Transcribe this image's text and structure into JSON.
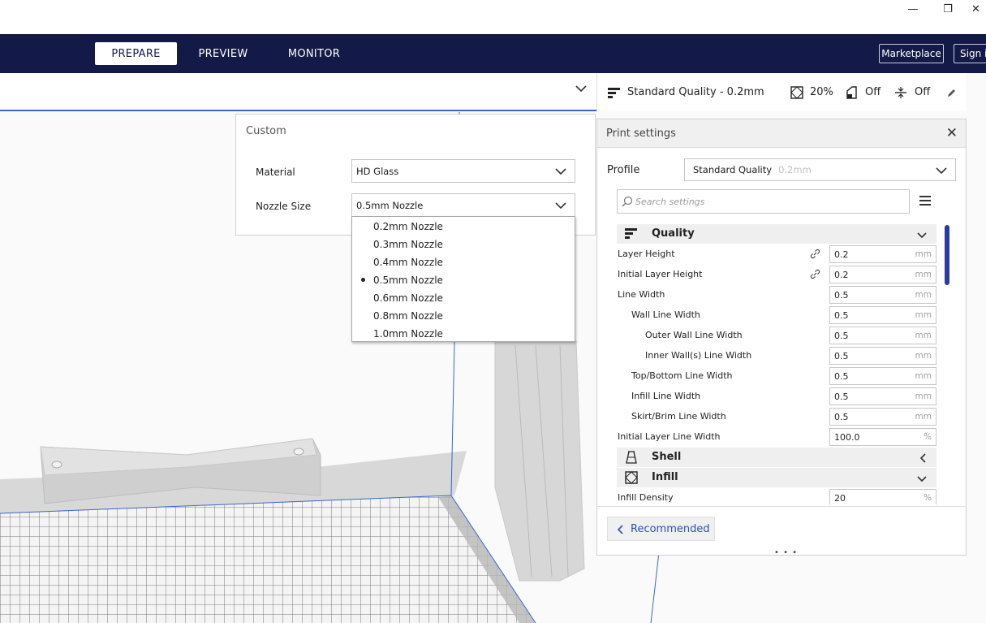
{
  "window": {
    "minimize_glyph": "—",
    "restore_glyph": "❐",
    "close_glyph": "✕"
  },
  "header": {
    "tabs": [
      {
        "label": "PREPARE",
        "active": true
      },
      {
        "label": "PREVIEW",
        "active": false
      },
      {
        "label": "MONITOR",
        "active": false
      }
    ],
    "marketplace_label": "Marketplace",
    "signin_label": "Sign in"
  },
  "material_panel": {
    "title": "Custom",
    "material_label": "Material",
    "material_value": "HD Glass",
    "nozzle_label": "Nozzle Size",
    "nozzle_value": "0.5mm Nozzle",
    "nozzle_options": [
      {
        "label": "0.2mm Nozzle",
        "selected": false
      },
      {
        "label": "0.3mm Nozzle",
        "selected": false
      },
      {
        "label": "0.4mm Nozzle",
        "selected": false
      },
      {
        "label": "0.5mm Nozzle",
        "selected": true
      },
      {
        "label": "0.6mm Nozzle",
        "selected": false
      },
      {
        "label": "0.8mm Nozzle",
        "selected": false
      },
      {
        "label": "1.0mm Nozzle",
        "selected": false
      }
    ]
  },
  "summary_bar": {
    "profile": "Standard Quality - 0.2mm",
    "infill": "20%",
    "support": "Off",
    "adhesion": "Off"
  },
  "print_settings": {
    "title": "Print settings",
    "profile_label": "Profile",
    "profile_value": "Standard Quality",
    "profile_sub": "0.2mm",
    "search_placeholder": "Search settings",
    "recommended_label": "Recommended",
    "handle_glyph": "• • •",
    "items": [
      {
        "kind": "category",
        "label": "Quality",
        "icon": "quality-icon",
        "expanded": true
      },
      {
        "kind": "setting",
        "label": "Layer Height",
        "value": "0.2",
        "unit": "mm",
        "indent": 0,
        "linked": true
      },
      {
        "kind": "setting",
        "label": "Initial Layer Height",
        "value": "0.2",
        "unit": "mm",
        "indent": 0,
        "linked": true
      },
      {
        "kind": "setting",
        "label": "Line Width",
        "value": "0.5",
        "unit": "mm",
        "indent": 0,
        "linked": false
      },
      {
        "kind": "setting",
        "label": "Wall Line Width",
        "value": "0.5",
        "unit": "mm",
        "indent": 1,
        "linked": false
      },
      {
        "kind": "setting",
        "label": "Outer Wall Line Width",
        "value": "0.5",
        "unit": "mm",
        "indent": 2,
        "linked": false
      },
      {
        "kind": "setting",
        "label": "Inner Wall(s) Line Width",
        "value": "0.5",
        "unit": "mm",
        "indent": 2,
        "linked": false
      },
      {
        "kind": "setting",
        "label": "Top/Bottom Line Width",
        "value": "0.5",
        "unit": "mm",
        "indent": 1,
        "linked": false
      },
      {
        "kind": "setting",
        "label": "Infill Line Width",
        "value": "0.5",
        "unit": "mm",
        "indent": 1,
        "linked": false
      },
      {
        "kind": "setting",
        "label": "Skirt/Brim Line Width",
        "value": "0.5",
        "unit": "mm",
        "indent": 1,
        "linked": false
      },
      {
        "kind": "setting",
        "label": "Initial Layer Line Width",
        "value": "100.0",
        "unit": "%",
        "indent": 0,
        "linked": false
      },
      {
        "kind": "category",
        "label": "Shell",
        "icon": "shell-icon",
        "expanded": false
      },
      {
        "kind": "category",
        "label": "Infill",
        "icon": "infill-icon",
        "expanded": true
      },
      {
        "kind": "setting",
        "label": "Infill Density",
        "value": "20",
        "unit": "%",
        "indent": 0,
        "linked": false
      }
    ]
  },
  "colors": {
    "header_bg": "#141a47",
    "accent_blue": "#2a52b0",
    "scroll_thumb": "#2a3aa3"
  }
}
